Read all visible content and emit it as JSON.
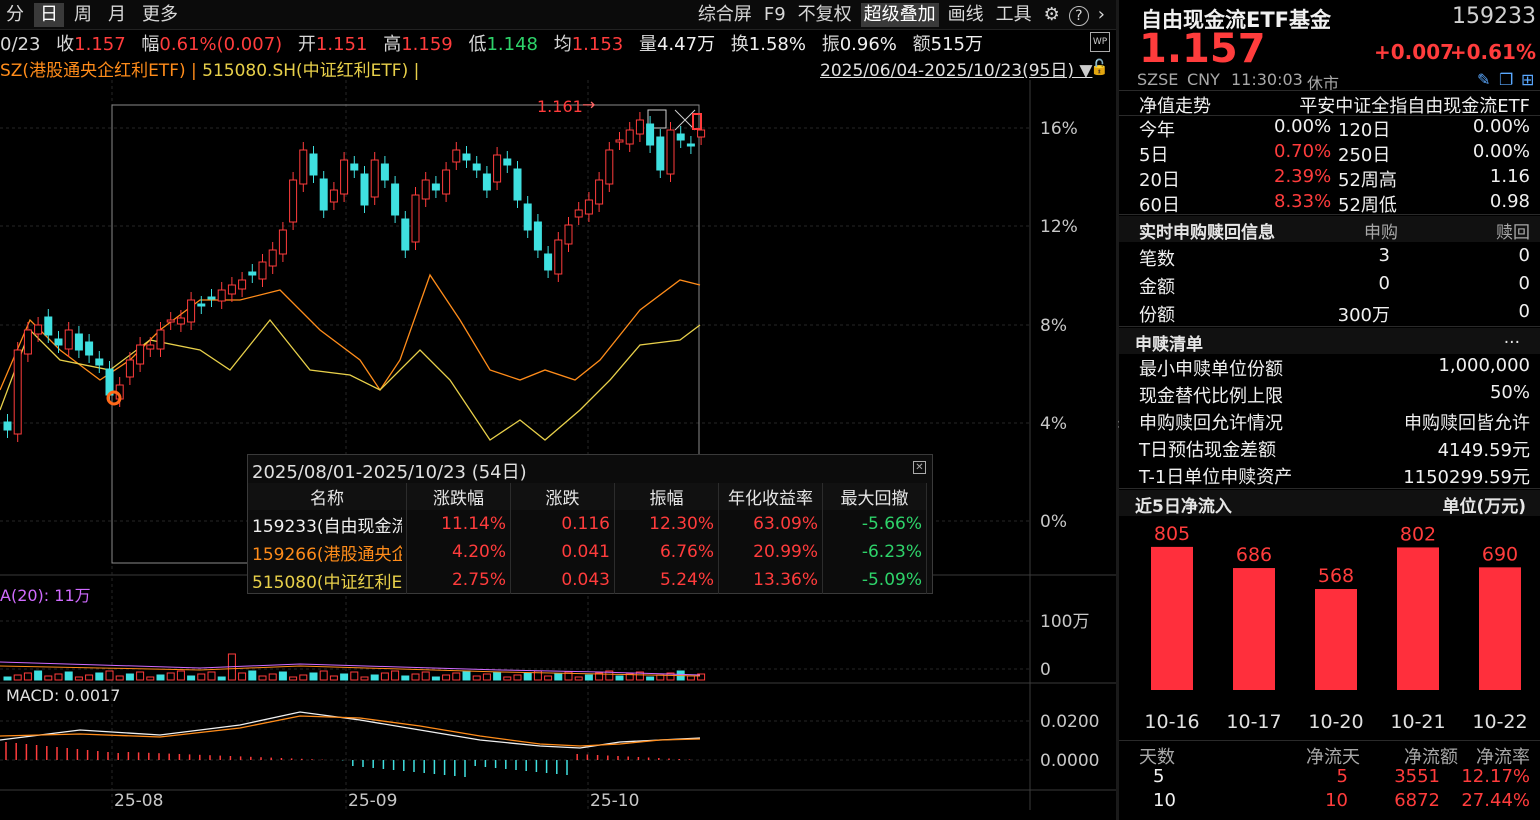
{
  "toolbar": {
    "left_tabs": [
      "分",
      "日",
      "周",
      "月",
      "更多"
    ],
    "active_tab": "日",
    "right_items": [
      "综合屏",
      "F9",
      "不复权",
      "超级叠加",
      "画线",
      "工具"
    ],
    "active_right": "超级叠加"
  },
  "quote_line": {
    "date": "0/23",
    "close_label": "收",
    "close": "1.157",
    "range_label": "幅",
    "range": "0.61%(0.007)",
    "open_label": "开",
    "open": "1.151",
    "high_label": "高",
    "high": "1.159",
    "low_label": "低",
    "low": "1.148",
    "avg_label": "均",
    "avg": "1.153",
    "vol_label": "量",
    "vol": "4.47万",
    "turnover_label": "换",
    "turnover": "1.58%",
    "amp_label": "振",
    "amp": "0.96%",
    "amount_label": "额",
    "amount": "515万"
  },
  "legend_line": {
    "series_a": "SZ(港股通央企红利ETF)",
    "sep": " | ",
    "series_b": "515080.SH(中证红利ETF)",
    "tail": " |"
  },
  "date_range": "2025/06/04-2025/10/23(95日)",
  "axis": {
    "pct_ticks": [
      "16%",
      "12%",
      "8%",
      "4%",
      "0%"
    ],
    "vol_ticks": [
      "100万",
      "0"
    ],
    "macd_ticks": [
      "0.0200",
      "0.0000"
    ],
    "x_ticks": [
      "25-08",
      "25-09",
      "25-10"
    ]
  },
  "annotations": {
    "high_marker": "1.161",
    "vol_label": "A(20): 11万",
    "macd_label": "MACD: 0.0017"
  },
  "popup": {
    "title": "2025/08/01-2025/10/23 (54日)",
    "headers": [
      "名称",
      "涨跌幅",
      "涨跌",
      "振幅",
      "年化收益率",
      "最大回撤"
    ],
    "rows": [
      {
        "name": "159233(自由现金流",
        "chg_pct": "11.14%",
        "chg": "0.116",
        "amp": "12.30%",
        "annual": "63.09%",
        "dd": "-5.66%",
        "color": "#f0f0f0"
      },
      {
        "name": "159266(港股通央企",
        "chg_pct": "4.20%",
        "chg": "0.041",
        "amp": "6.76%",
        "annual": "20.99%",
        "dd": "-6.23%",
        "color": "#ff8c1a"
      },
      {
        "name": "515080(中证红利E",
        "chg_pct": "2.75%",
        "chg": "0.043",
        "amp": "5.24%",
        "annual": "13.36%",
        "dd": "-5.09%",
        "color": "#e8d04a"
      }
    ]
  },
  "right": {
    "fund_name": "自由现金流ETF基金",
    "code": "159233",
    "price": "1.157",
    "change": "+0.007",
    "change_pct": "+0.61%",
    "exchange": "SZSE",
    "currency": "CNY",
    "time": "11:30:03",
    "status": "休市",
    "nav_label": "净值走势",
    "index_name": "平安中证全指自由现金流ETF",
    "perf": [
      {
        "l1": "今年",
        "v1": "0.00%",
        "c1": "white",
        "l2": "120日",
        "v2": "0.00%"
      },
      {
        "l1": "5日",
        "v1": "0.70%",
        "c1": "red",
        "l2": "250日",
        "v2": "0.00%"
      },
      {
        "l1": "20日",
        "v1": "2.39%",
        "c1": "red",
        "l2": "52周高",
        "v2": "1.16"
      },
      {
        "l1": "60日",
        "v1": "8.33%",
        "c1": "red",
        "l2": "52周低",
        "v2": "0.98"
      }
    ],
    "sub_header": {
      "title": "实时申购赎回信息",
      "col1": "申购",
      "col2": "赎回"
    },
    "sub_rows": [
      {
        "label": "笔数",
        "v1": "3",
        "v2": "0"
      },
      {
        "label": "金额",
        "v1": "0",
        "v2": "0"
      },
      {
        "label": "份额",
        "v1": "300万",
        "v2": "0"
      }
    ],
    "list_header": "申赎清单",
    "list_more": "...",
    "list_rows": [
      {
        "label": "最小申赎单位份额",
        "value": "1,000,000"
      },
      {
        "label": "现金替代比例上限",
        "value": "50%"
      },
      {
        "label": "申购赎回允许情况",
        "value": "申购赎回皆允许"
      },
      {
        "label": "T日预估现金差额",
        "value": "4149.59元"
      },
      {
        "label": "T-1日单位申赎资产",
        "value": "1150299.59元"
      }
    ],
    "flow_header": "近5日净流入",
    "flow_unit": "单位(万元)",
    "flow_stats_header": [
      "天数",
      "净流天",
      "净流额",
      "净流率"
    ],
    "flow_stats": [
      {
        "days": "5",
        "flow_days": "5",
        "amount": "3551",
        "rate": "12.17%"
      },
      {
        "days": "10",
        "flow_days": "10",
        "amount": "6872",
        "rate": "27.44%"
      }
    ]
  },
  "chart_data": {
    "type": "bar",
    "categories": [
      "10-16",
      "10-17",
      "10-20",
      "10-21",
      "10-22"
    ],
    "values": [
      805,
      686,
      568,
      802,
      690
    ],
    "title": "近5日净流入",
    "ylabel": "单位(万元)",
    "bar_color": "#ff2f3c"
  }
}
